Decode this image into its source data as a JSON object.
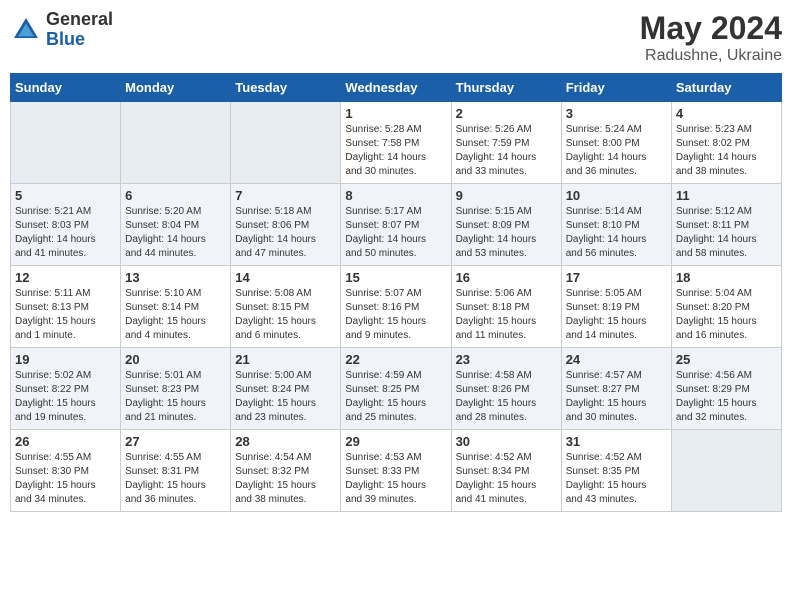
{
  "logo": {
    "general": "General",
    "blue": "Blue"
  },
  "title": {
    "month_year": "May 2024",
    "location": "Radushne, Ukraine"
  },
  "days_of_week": [
    "Sunday",
    "Monday",
    "Tuesday",
    "Wednesday",
    "Thursday",
    "Friday",
    "Saturday"
  ],
  "weeks": [
    [
      {
        "day": "",
        "info": ""
      },
      {
        "day": "",
        "info": ""
      },
      {
        "day": "",
        "info": ""
      },
      {
        "day": "1",
        "info": "Sunrise: 5:28 AM\nSunset: 7:58 PM\nDaylight: 14 hours\nand 30 minutes."
      },
      {
        "day": "2",
        "info": "Sunrise: 5:26 AM\nSunset: 7:59 PM\nDaylight: 14 hours\nand 33 minutes."
      },
      {
        "day": "3",
        "info": "Sunrise: 5:24 AM\nSunset: 8:00 PM\nDaylight: 14 hours\nand 36 minutes."
      },
      {
        "day": "4",
        "info": "Sunrise: 5:23 AM\nSunset: 8:02 PM\nDaylight: 14 hours\nand 38 minutes."
      }
    ],
    [
      {
        "day": "5",
        "info": "Sunrise: 5:21 AM\nSunset: 8:03 PM\nDaylight: 14 hours\nand 41 minutes."
      },
      {
        "day": "6",
        "info": "Sunrise: 5:20 AM\nSunset: 8:04 PM\nDaylight: 14 hours\nand 44 minutes."
      },
      {
        "day": "7",
        "info": "Sunrise: 5:18 AM\nSunset: 8:06 PM\nDaylight: 14 hours\nand 47 minutes."
      },
      {
        "day": "8",
        "info": "Sunrise: 5:17 AM\nSunset: 8:07 PM\nDaylight: 14 hours\nand 50 minutes."
      },
      {
        "day": "9",
        "info": "Sunrise: 5:15 AM\nSunset: 8:09 PM\nDaylight: 14 hours\nand 53 minutes."
      },
      {
        "day": "10",
        "info": "Sunrise: 5:14 AM\nSunset: 8:10 PM\nDaylight: 14 hours\nand 56 minutes."
      },
      {
        "day": "11",
        "info": "Sunrise: 5:12 AM\nSunset: 8:11 PM\nDaylight: 14 hours\nand 58 minutes."
      }
    ],
    [
      {
        "day": "12",
        "info": "Sunrise: 5:11 AM\nSunset: 8:13 PM\nDaylight: 15 hours\nand 1 minute."
      },
      {
        "day": "13",
        "info": "Sunrise: 5:10 AM\nSunset: 8:14 PM\nDaylight: 15 hours\nand 4 minutes."
      },
      {
        "day": "14",
        "info": "Sunrise: 5:08 AM\nSunset: 8:15 PM\nDaylight: 15 hours\nand 6 minutes."
      },
      {
        "day": "15",
        "info": "Sunrise: 5:07 AM\nSunset: 8:16 PM\nDaylight: 15 hours\nand 9 minutes."
      },
      {
        "day": "16",
        "info": "Sunrise: 5:06 AM\nSunset: 8:18 PM\nDaylight: 15 hours\nand 11 minutes."
      },
      {
        "day": "17",
        "info": "Sunrise: 5:05 AM\nSunset: 8:19 PM\nDaylight: 15 hours\nand 14 minutes."
      },
      {
        "day": "18",
        "info": "Sunrise: 5:04 AM\nSunset: 8:20 PM\nDaylight: 15 hours\nand 16 minutes."
      }
    ],
    [
      {
        "day": "19",
        "info": "Sunrise: 5:02 AM\nSunset: 8:22 PM\nDaylight: 15 hours\nand 19 minutes."
      },
      {
        "day": "20",
        "info": "Sunrise: 5:01 AM\nSunset: 8:23 PM\nDaylight: 15 hours\nand 21 minutes."
      },
      {
        "day": "21",
        "info": "Sunrise: 5:00 AM\nSunset: 8:24 PM\nDaylight: 15 hours\nand 23 minutes."
      },
      {
        "day": "22",
        "info": "Sunrise: 4:59 AM\nSunset: 8:25 PM\nDaylight: 15 hours\nand 25 minutes."
      },
      {
        "day": "23",
        "info": "Sunrise: 4:58 AM\nSunset: 8:26 PM\nDaylight: 15 hours\nand 28 minutes."
      },
      {
        "day": "24",
        "info": "Sunrise: 4:57 AM\nSunset: 8:27 PM\nDaylight: 15 hours\nand 30 minutes."
      },
      {
        "day": "25",
        "info": "Sunrise: 4:56 AM\nSunset: 8:29 PM\nDaylight: 15 hours\nand 32 minutes."
      }
    ],
    [
      {
        "day": "26",
        "info": "Sunrise: 4:55 AM\nSunset: 8:30 PM\nDaylight: 15 hours\nand 34 minutes."
      },
      {
        "day": "27",
        "info": "Sunrise: 4:55 AM\nSunset: 8:31 PM\nDaylight: 15 hours\nand 36 minutes."
      },
      {
        "day": "28",
        "info": "Sunrise: 4:54 AM\nSunset: 8:32 PM\nDaylight: 15 hours\nand 38 minutes."
      },
      {
        "day": "29",
        "info": "Sunrise: 4:53 AM\nSunset: 8:33 PM\nDaylight: 15 hours\nand 39 minutes."
      },
      {
        "day": "30",
        "info": "Sunrise: 4:52 AM\nSunset: 8:34 PM\nDaylight: 15 hours\nand 41 minutes."
      },
      {
        "day": "31",
        "info": "Sunrise: 4:52 AM\nSunset: 8:35 PM\nDaylight: 15 hours\nand 43 minutes."
      },
      {
        "day": "",
        "info": ""
      }
    ]
  ]
}
